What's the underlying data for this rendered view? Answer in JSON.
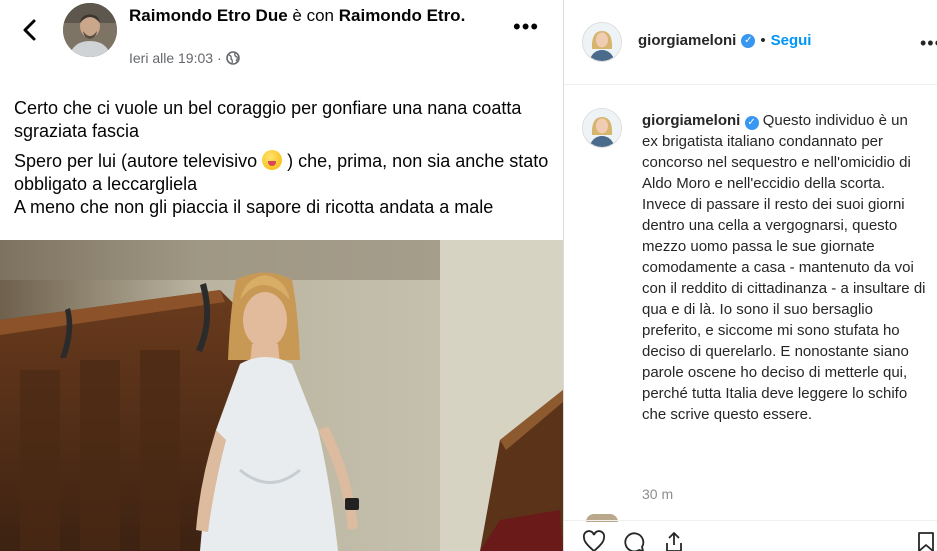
{
  "facebook_post": {
    "author": "Raimondo Etro Due",
    "with_word": "è con",
    "tagged": "Raimondo Etro.",
    "time": "Ieri alle 19:03 ·",
    "privacy_icon": "globe-icon",
    "menu_icon": "more-horizontal-icon",
    "text_line1": "Certo che ci vuole un bel coraggio per gonfiare una nana coatta sgraziata fascia",
    "text_line2a": "Spero per lui (autore televisivo",
    "text_line2b": ") che, prima, non sia anche stato obbligato a leccargliela",
    "text_line3": "A meno che non gli piaccia il sapore di ricotta andata a male"
  },
  "instagram_post": {
    "username": "giorgiameloni",
    "follow_separator": "•",
    "follow_label": "Segui",
    "caption": "Questo individuo è un ex brigatista italiano condannato per concorso nel sequestro e nell'omicidio di Aldo Moro e nell'eccidio della scorta.\nInvece di passare il resto dei suoi giorni dentro una cella a vergognarsi, questo mezzo uomo passa le sue giornate comodamente a casa - mantenuto da voi con il reddito di cittadinanza - a insultare di qua e di là. Io sono il suo bersaglio preferito, e siccome mi sono stufata ho deciso di querelarlo. E nonostante siano parole oscene ho deciso di metterle qui, perché tutta Italia deve leggere lo schifo che scrive questo essere.",
    "time": "30 m"
  }
}
